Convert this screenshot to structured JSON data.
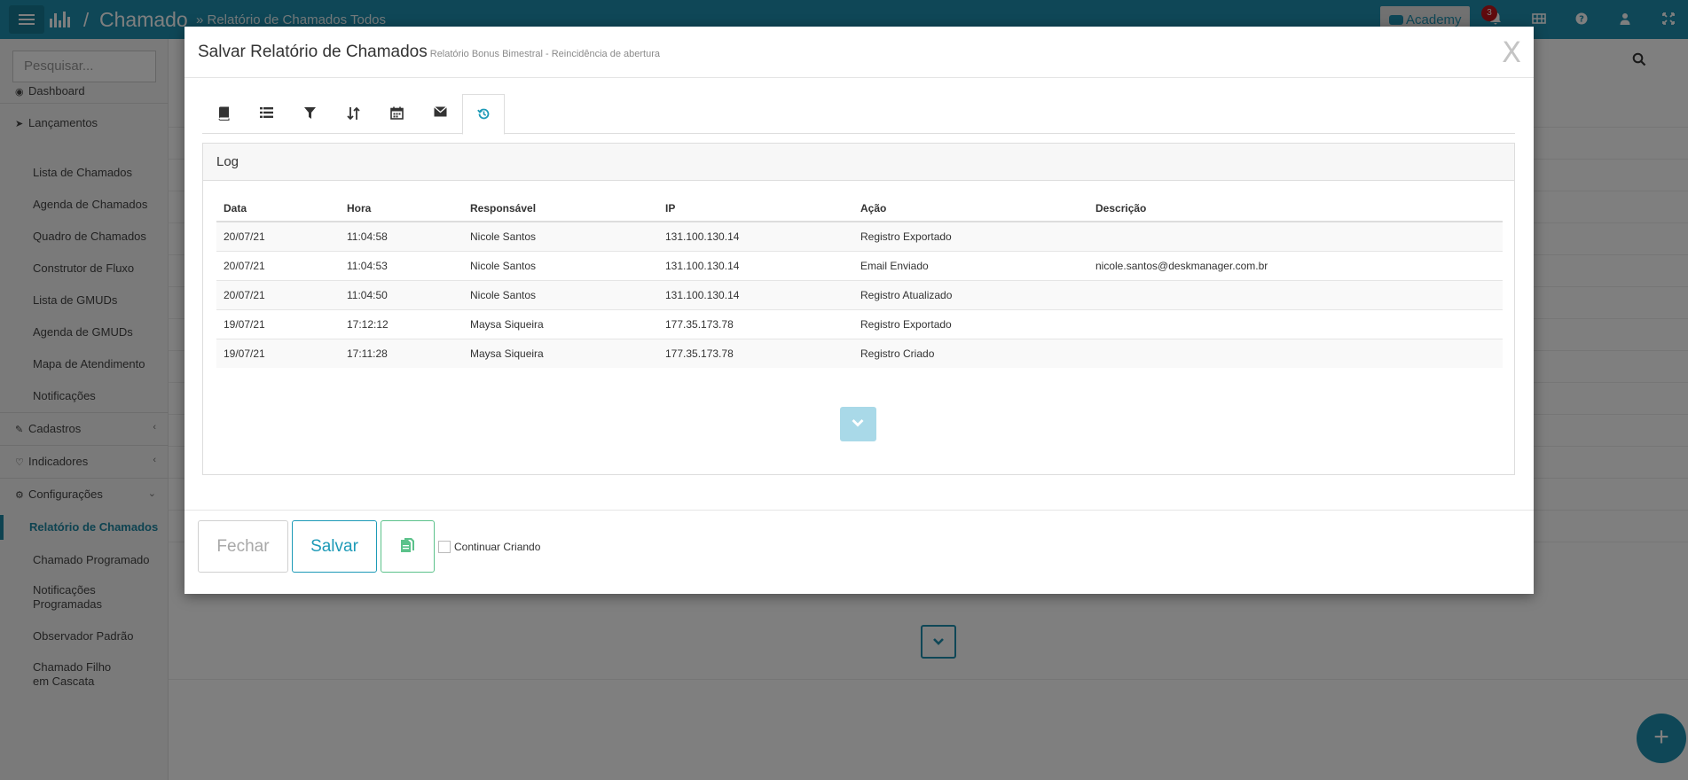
{
  "topbar": {
    "app_title": "Chamado",
    "breadcrumb": "» Relatório de Chamados Todos",
    "academy_label": "Academy",
    "notification_count": "3"
  },
  "sidebar": {
    "search_placeholder": "Pesquisar...",
    "items": [
      {
        "label": "Dashboard"
      },
      {
        "label": "Lançamentos"
      },
      {
        "label": "Lista de Chamados"
      },
      {
        "label": "Agenda de Chamados"
      },
      {
        "label": "Quadro de Chamados"
      },
      {
        "label": "Construtor de Fluxo"
      },
      {
        "label": "Lista de GMUDs"
      },
      {
        "label": "Agenda de GMUDs"
      },
      {
        "label": "Mapa de Atendimento"
      },
      {
        "label": "Notificações"
      },
      {
        "label": "Cadastros"
      },
      {
        "label": "Indicadores"
      },
      {
        "label": "Configurações"
      },
      {
        "label": "Relatório de Chamados"
      },
      {
        "label": "Chamado Programado"
      },
      {
        "label": "Notificações Programadas"
      },
      {
        "label": "Observador Padrão"
      },
      {
        "label": "Chamado Filho em Cascata"
      }
    ]
  },
  "modal": {
    "title": "Salvar Relatório de Chamados",
    "subtitle": "Relatório Bonus Bimestral - Reincidência de abertura",
    "close_label": "X",
    "tabs": [
      {
        "icon": "book-icon"
      },
      {
        "icon": "list-icon"
      },
      {
        "icon": "filter-icon"
      },
      {
        "icon": "sort-icon"
      },
      {
        "icon": "calendar-icon"
      },
      {
        "icon": "envelope-icon"
      },
      {
        "icon": "history-icon"
      }
    ],
    "panel_title": "Log",
    "table": {
      "headers": [
        "Data",
        "Hora",
        "Responsável",
        "IP",
        "Ação",
        "Descrição"
      ],
      "rows": [
        [
          "20/07/21",
          "11:04:58",
          "Nicole Santos",
          "131.100.130.14",
          "Registro Exportado",
          ""
        ],
        [
          "20/07/21",
          "11:04:53",
          "Nicole Santos",
          "131.100.130.14",
          "Email Enviado",
          "nicole.santos@deskmanager.com.br"
        ],
        [
          "20/07/21",
          "11:04:50",
          "Nicole Santos",
          "131.100.130.14",
          "Registro Atualizado",
          ""
        ],
        [
          "19/07/21",
          "17:12:12",
          "Maysa Siqueira",
          "177.35.173.78",
          "Registro Exportado",
          ""
        ],
        [
          "19/07/21",
          "17:11:28",
          "Maysa Siqueira",
          "177.35.173.78",
          "Registro Criado",
          ""
        ]
      ]
    },
    "footer": {
      "close_button": "Fechar",
      "save_button": "Salvar",
      "continue_label": "Continuar Criando"
    }
  },
  "colors": {
    "primary": "#1f8fae",
    "accent_green": "#5cc28b",
    "badge_red": "#c0141a"
  }
}
